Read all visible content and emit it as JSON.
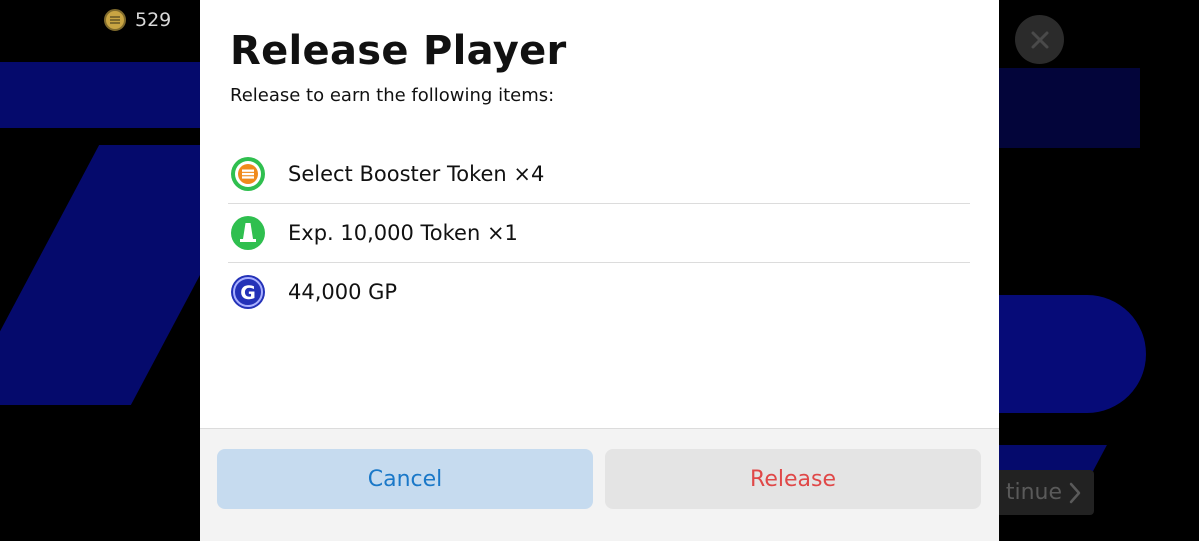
{
  "background": {
    "coins": {
      "value": "529",
      "icon": "coin-icon"
    },
    "continue_label": "tinue"
  },
  "dialog": {
    "title": "Release Player",
    "subtitle": "Release to earn the following items:",
    "items": [
      {
        "label": "Select Booster Token ×4",
        "icon": "booster-token-icon"
      },
      {
        "label": "Exp. 10,000 Token ×1",
        "icon": "exp-token-icon"
      },
      {
        "label": "44,000 GP",
        "icon": "gp-icon"
      }
    ],
    "buttons": {
      "cancel": "Cancel",
      "release": "Release"
    }
  },
  "colors": {
    "cancel_bg": "#c6dbef",
    "cancel_text": "#1a78c8",
    "release_bg": "#e4e4e4",
    "release_text": "#e04848",
    "booster_green": "#2fbf4f",
    "booster_orange": "#f08a1c",
    "exp_green": "#2fbf4f",
    "gp_blue": "#2432b8"
  }
}
